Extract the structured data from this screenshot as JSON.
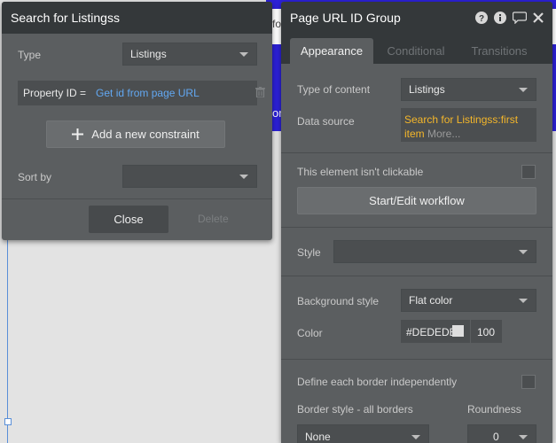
{
  "search_panel": {
    "title": "Search for Listingss",
    "type_label": "Type",
    "type_value": "Listings",
    "constraint_key": "Property ID =",
    "constraint_value": "Get id from page URL",
    "add_constraint_label": "Add a new constraint",
    "sort_label": "Sort by",
    "sort_value": "",
    "close_label": "Close",
    "delete_label": "Delete"
  },
  "prop_panel": {
    "title": "Page URL ID Group",
    "tabs": [
      {
        "label": "Appearance",
        "active": true
      },
      {
        "label": "Conditional",
        "active": false
      },
      {
        "label": "Transitions",
        "active": false
      }
    ],
    "content_type_label": "Type of content",
    "content_type_value": "Listings",
    "data_source_label": "Data source",
    "data_source_expr": "Search for Listingss:first item",
    "data_source_more": "More...",
    "clickable_label": "This element isn't clickable",
    "workflow_button": "Start/Edit workflow",
    "style_label": "Style",
    "style_value": "",
    "bg_style_label": "Background style",
    "bg_style_value": "Flat color",
    "color_label": "Color",
    "color_hex": "#DEDEDE",
    "color_opacity": "100",
    "border_independent_label": "Define each border independently",
    "border_style_label": "Border style - all borders",
    "border_style_value": "None",
    "roundness_label": "Roundness",
    "roundness_value": "0"
  },
  "canvas": {
    "peek_text_1": "fo",
    "peek_text_2": "or"
  },
  "colors": {
    "panel_bg": "#5b5e60",
    "header_bg": "#34383a",
    "link_blue": "#62a8f2",
    "expression_orange": "#f4b62a",
    "swatch": "#DEDEDE"
  }
}
